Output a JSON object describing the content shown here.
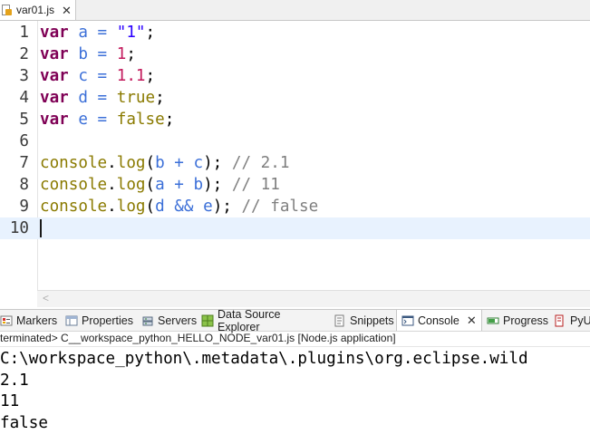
{
  "editor_tab": {
    "filename": "var01.js",
    "close_glyph": "✕"
  },
  "code": {
    "lines": [
      {
        "n": "1",
        "tokens": [
          {
            "t": "var",
            "c": "kw"
          },
          {
            "t": " ",
            "c": "plain"
          },
          {
            "t": "a",
            "c": "id"
          },
          {
            "t": " = ",
            "c": "op"
          },
          {
            "t": "\"1\"",
            "c": "str"
          },
          {
            "t": ";",
            "c": "plain"
          }
        ]
      },
      {
        "n": "2",
        "tokens": [
          {
            "t": "var",
            "c": "kw"
          },
          {
            "t": " ",
            "c": "plain"
          },
          {
            "t": "b",
            "c": "id"
          },
          {
            "t": " = ",
            "c": "op"
          },
          {
            "t": "1",
            "c": "num"
          },
          {
            "t": ";",
            "c": "plain"
          }
        ]
      },
      {
        "n": "3",
        "tokens": [
          {
            "t": "var",
            "c": "kw"
          },
          {
            "t": " ",
            "c": "plain"
          },
          {
            "t": "c",
            "c": "id"
          },
          {
            "t": " = ",
            "c": "op"
          },
          {
            "t": "1.1",
            "c": "num"
          },
          {
            "t": ";",
            "c": "plain"
          }
        ]
      },
      {
        "n": "4",
        "tokens": [
          {
            "t": "var",
            "c": "kw"
          },
          {
            "t": " ",
            "c": "plain"
          },
          {
            "t": "d",
            "c": "id"
          },
          {
            "t": " = ",
            "c": "op"
          },
          {
            "t": "true",
            "c": "bool"
          },
          {
            "t": ";",
            "c": "plain"
          }
        ]
      },
      {
        "n": "5",
        "tokens": [
          {
            "t": "var",
            "c": "kw"
          },
          {
            "t": " ",
            "c": "plain"
          },
          {
            "t": "e",
            "c": "id"
          },
          {
            "t": " = ",
            "c": "op"
          },
          {
            "t": "false",
            "c": "bool"
          },
          {
            "t": ";",
            "c": "plain"
          }
        ]
      },
      {
        "n": "6",
        "tokens": []
      },
      {
        "n": "7",
        "tokens": [
          {
            "t": "console",
            "c": "fn"
          },
          {
            "t": ".",
            "c": "plain"
          },
          {
            "t": "log",
            "c": "fn"
          },
          {
            "t": "(",
            "c": "plain"
          },
          {
            "t": "b",
            "c": "id"
          },
          {
            "t": " + ",
            "c": "op"
          },
          {
            "t": "c",
            "c": "id"
          },
          {
            "t": "); ",
            "c": "plain"
          },
          {
            "t": "// 2.1",
            "c": "cm"
          }
        ]
      },
      {
        "n": "8",
        "tokens": [
          {
            "t": "console",
            "c": "fn"
          },
          {
            "t": ".",
            "c": "plain"
          },
          {
            "t": "log",
            "c": "fn"
          },
          {
            "t": "(",
            "c": "plain"
          },
          {
            "t": "a",
            "c": "id"
          },
          {
            "t": " + ",
            "c": "op"
          },
          {
            "t": "b",
            "c": "id"
          },
          {
            "t": "); ",
            "c": "plain"
          },
          {
            "t": "// 11",
            "c": "cm"
          }
        ]
      },
      {
        "n": "9",
        "tokens": [
          {
            "t": "console",
            "c": "fn"
          },
          {
            "t": ".",
            "c": "plain"
          },
          {
            "t": "log",
            "c": "fn"
          },
          {
            "t": "(",
            "c": "plain"
          },
          {
            "t": "d",
            "c": "id"
          },
          {
            "t": " && ",
            "c": "op"
          },
          {
            "t": "e",
            "c": "id"
          },
          {
            "t": "); ",
            "c": "plain"
          },
          {
            "t": "// false",
            "c": "cm"
          }
        ]
      },
      {
        "n": "10",
        "tokens": [],
        "current": true
      }
    ]
  },
  "views": {
    "tabs": [
      {
        "label": "Markers",
        "icon": "markers-icon"
      },
      {
        "label": "Properties",
        "icon": "properties-icon"
      },
      {
        "label": "Servers",
        "icon": "servers-icon"
      },
      {
        "label": "Data Source Explorer",
        "icon": "data-source-explorer-icon"
      },
      {
        "label": "Snippets",
        "icon": "snippets-icon"
      },
      {
        "label": "Console",
        "icon": "console-icon",
        "active": true,
        "close_glyph": "✕"
      },
      {
        "label": "Progress",
        "icon": "progress-icon"
      },
      {
        "label": "PyU",
        "icon": "pyunit-icon"
      }
    ]
  },
  "console": {
    "status": "<terminated> C__workspace_python_HELLO_NODE_var01.js [Node.js application]",
    "lines": [
      "C:\\workspace_python\\.metadata\\.plugins\\org.eclipse.wild",
      "2.1",
      "11",
      "false"
    ]
  },
  "colors": {
    "keyword": "#7f0055",
    "identifier": "#3b6fd8",
    "string": "#2a00ff",
    "number": "#c2185b",
    "boolean": "#8a7a00",
    "comment": "#7f7f7f",
    "current_line": "#e8f2fe"
  }
}
